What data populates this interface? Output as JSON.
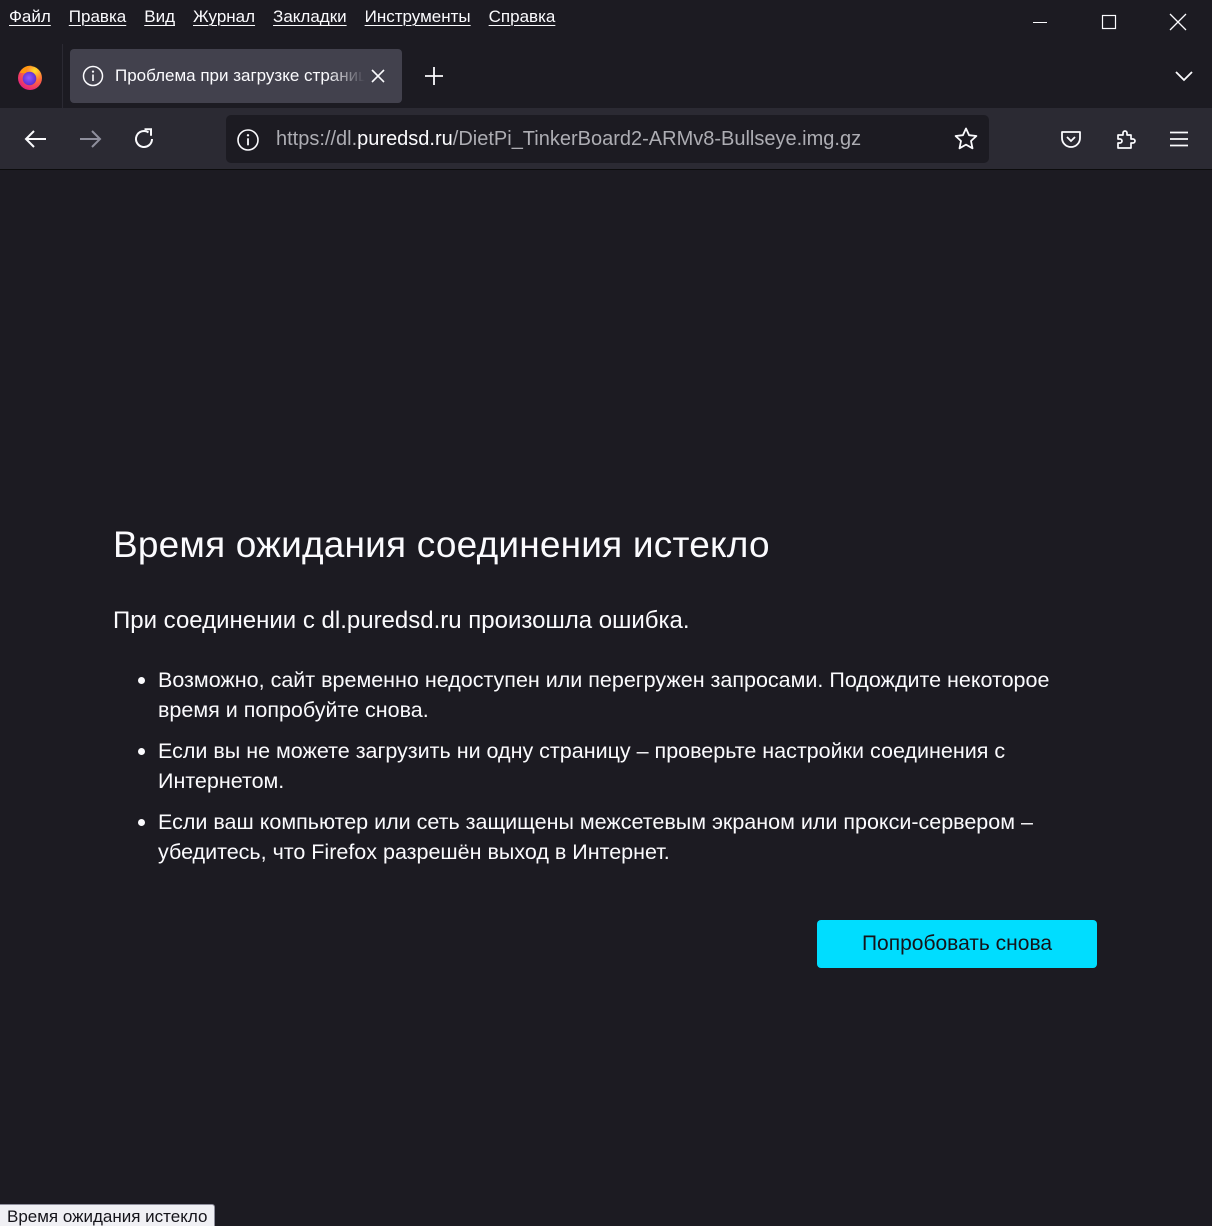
{
  "menu": {
    "items": [
      {
        "label": "Файл"
      },
      {
        "label": "Правка"
      },
      {
        "label": "Вид"
      },
      {
        "label": "Журнал"
      },
      {
        "label": "Закладки"
      },
      {
        "label": "Инструменты"
      },
      {
        "label": "Справка"
      }
    ]
  },
  "tab": {
    "title": "Проблема при загрузке страницы",
    "icon": "info-icon"
  },
  "urlbar": {
    "scheme_prefix": "https://dl.",
    "domain": "puredsd.ru",
    "path": "/DietPi_TinkerBoard2-ARMv8-Bullseye.img.gz"
  },
  "error": {
    "title": "Время ожидания соединения истекло",
    "description": "При соединении с dl.puredsd.ru произошла ошибка.",
    "items": [
      "Возможно, сайт временно недоступен или перегружен запросами. Подождите некоторое время и попробуйте снова.",
      "Если вы не можете загрузить ни одну страницу – проверьте настройки соединения с Интернетом.",
      "Если ваш компьютер или сеть защищены межсетевым экраном или прокси-сервером – убедитесь, что Firefox разрешён выход в Интернет."
    ],
    "retry_label": "Попробовать снова"
  },
  "status": {
    "text": "Время ожидания истекло"
  },
  "colors": {
    "background": "#1c1b22",
    "toolbar": "#2b2a33",
    "tab_selected": "#42414d",
    "accent": "#00ddff"
  }
}
